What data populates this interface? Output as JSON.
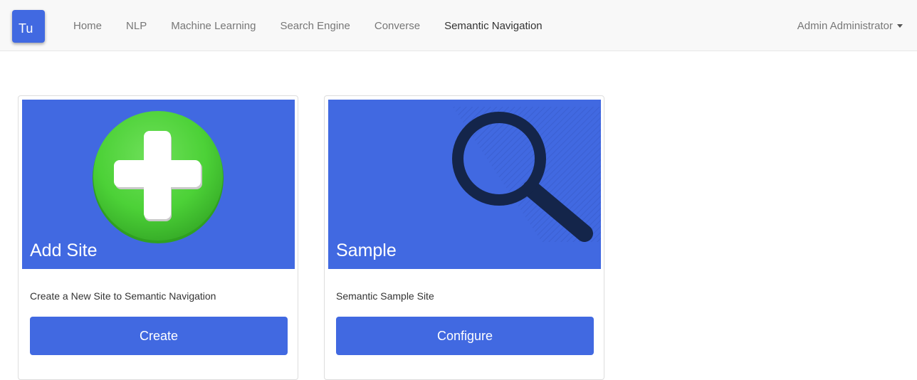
{
  "brand": {
    "logo_text": "Tu"
  },
  "nav": {
    "items": [
      {
        "label": "Home",
        "active": false
      },
      {
        "label": "NLP",
        "active": false
      },
      {
        "label": "Machine Learning",
        "active": false
      },
      {
        "label": "Search Engine",
        "active": false
      },
      {
        "label": "Converse",
        "active": false
      },
      {
        "label": "Semantic Navigation",
        "active": true
      }
    ],
    "user": "Admin Administrator"
  },
  "cards": [
    {
      "title": "Add Site",
      "description": "Create a New Site to Semantic Navigation",
      "button_label": "Create",
      "icon": "plus-circle-icon"
    },
    {
      "title": "Sample",
      "description": "Semantic Sample Site",
      "button_label": "Configure",
      "icon": "magnifier-icon"
    }
  ],
  "colors": {
    "accent": "#4169e1",
    "plus_green": "#4cd137",
    "magnifier_dark": "#14254a",
    "navbar_bg": "#f8f8f8"
  }
}
